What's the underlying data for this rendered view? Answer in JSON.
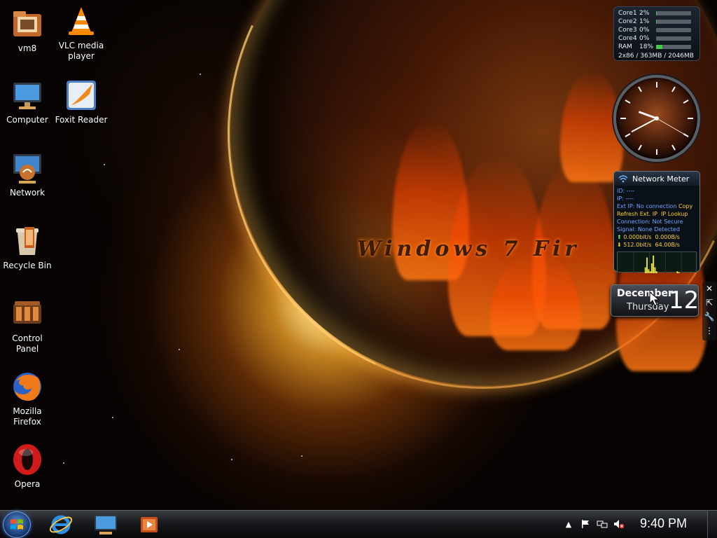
{
  "desktop": {
    "icons": [
      {
        "label": "vm8",
        "icon": "folder-icon"
      },
      {
        "label": "VLC media player",
        "icon": "vlc-cone-icon"
      },
      {
        "label": "Computer",
        "icon": "computer-icon"
      },
      {
        "label": "Foxit Reader",
        "icon": "foxit-reader-icon"
      },
      {
        "label": "Network",
        "icon": "network-icon"
      },
      {
        "label": "Recycle Bin",
        "icon": "recycle-bin-icon"
      },
      {
        "label": "Control Panel",
        "icon": "control-panel-icon"
      },
      {
        "label": "Mozilla Firefox",
        "icon": "firefox-icon"
      },
      {
        "label": "Opera",
        "icon": "opera-icon"
      }
    ],
    "wallpaper_text": "Windows 7 Fir"
  },
  "cpu_meter": {
    "rows": [
      {
        "name": "Core1",
        "value": "2%",
        "fill": 0.02
      },
      {
        "name": "Core2",
        "value": "1%",
        "fill": 0.01
      },
      {
        "name": "Core3",
        "value": "0%",
        "fill": 0.0
      },
      {
        "name": "Core4",
        "value": "0%",
        "fill": 0.0
      },
      {
        "name": "RAM",
        "value": "18%",
        "fill": 0.18
      }
    ],
    "footer": "2x86 / 363MB / 2046MB",
    "bar_fill_color": "#43c84a"
  },
  "clock": {
    "hour": 9,
    "minute": 40,
    "second": 20
  },
  "network_meter": {
    "title": "Network Meter",
    "id": "ID: ----",
    "ip": "IP: ----",
    "ext_ip_label": "Ext IP: No connection",
    "copy": "Copy",
    "refresh": "Refresh Ext. IP",
    "lookup": "IP Lookup",
    "connection": "Connection: Not Secure",
    "signal": "Signal: None Detected",
    "up_bits": "0.000bit/s",
    "up_bytes": "0.000B/s",
    "down_bits": "512.0bit/s",
    "down_bytes": "64.00B/s",
    "graph_values": [
      0,
      0,
      0,
      0,
      0,
      0,
      0,
      0,
      0,
      0,
      0,
      0,
      0,
      0,
      0,
      0,
      0,
      0.3,
      0.8,
      0.2,
      0.1,
      0.5,
      0.9,
      0.3,
      0.1,
      0,
      0,
      0,
      0,
      0,
      0,
      0,
      0,
      0,
      0,
      0,
      0,
      0.1,
      0.05,
      0,
      0,
      0,
      0,
      0,
      0,
      0,
      0,
      0,
      0,
      0
    ]
  },
  "calendar": {
    "month": "December",
    "weekday": "Thursday",
    "day": "12"
  },
  "gadget_tools": [
    {
      "name": "close-icon",
      "glyph": "✕"
    },
    {
      "name": "resize-icon",
      "glyph": "⇱"
    },
    {
      "name": "wrench-icon",
      "glyph": "🔧"
    },
    {
      "name": "drag-grip-icon",
      "glyph": "⋮"
    }
  ],
  "taskbar": {
    "start_icon": "windows-start-orb-icon",
    "pinned": [
      {
        "name": "internet-explorer-icon"
      },
      {
        "name": "computer-icon"
      },
      {
        "name": "media-player-icon"
      }
    ],
    "tray": {
      "icons": [
        "show-hidden-icons-icon",
        "action-center-flag-icon",
        "network-icon",
        "volume-muted-icon"
      ],
      "time": "9:40 PM"
    }
  }
}
